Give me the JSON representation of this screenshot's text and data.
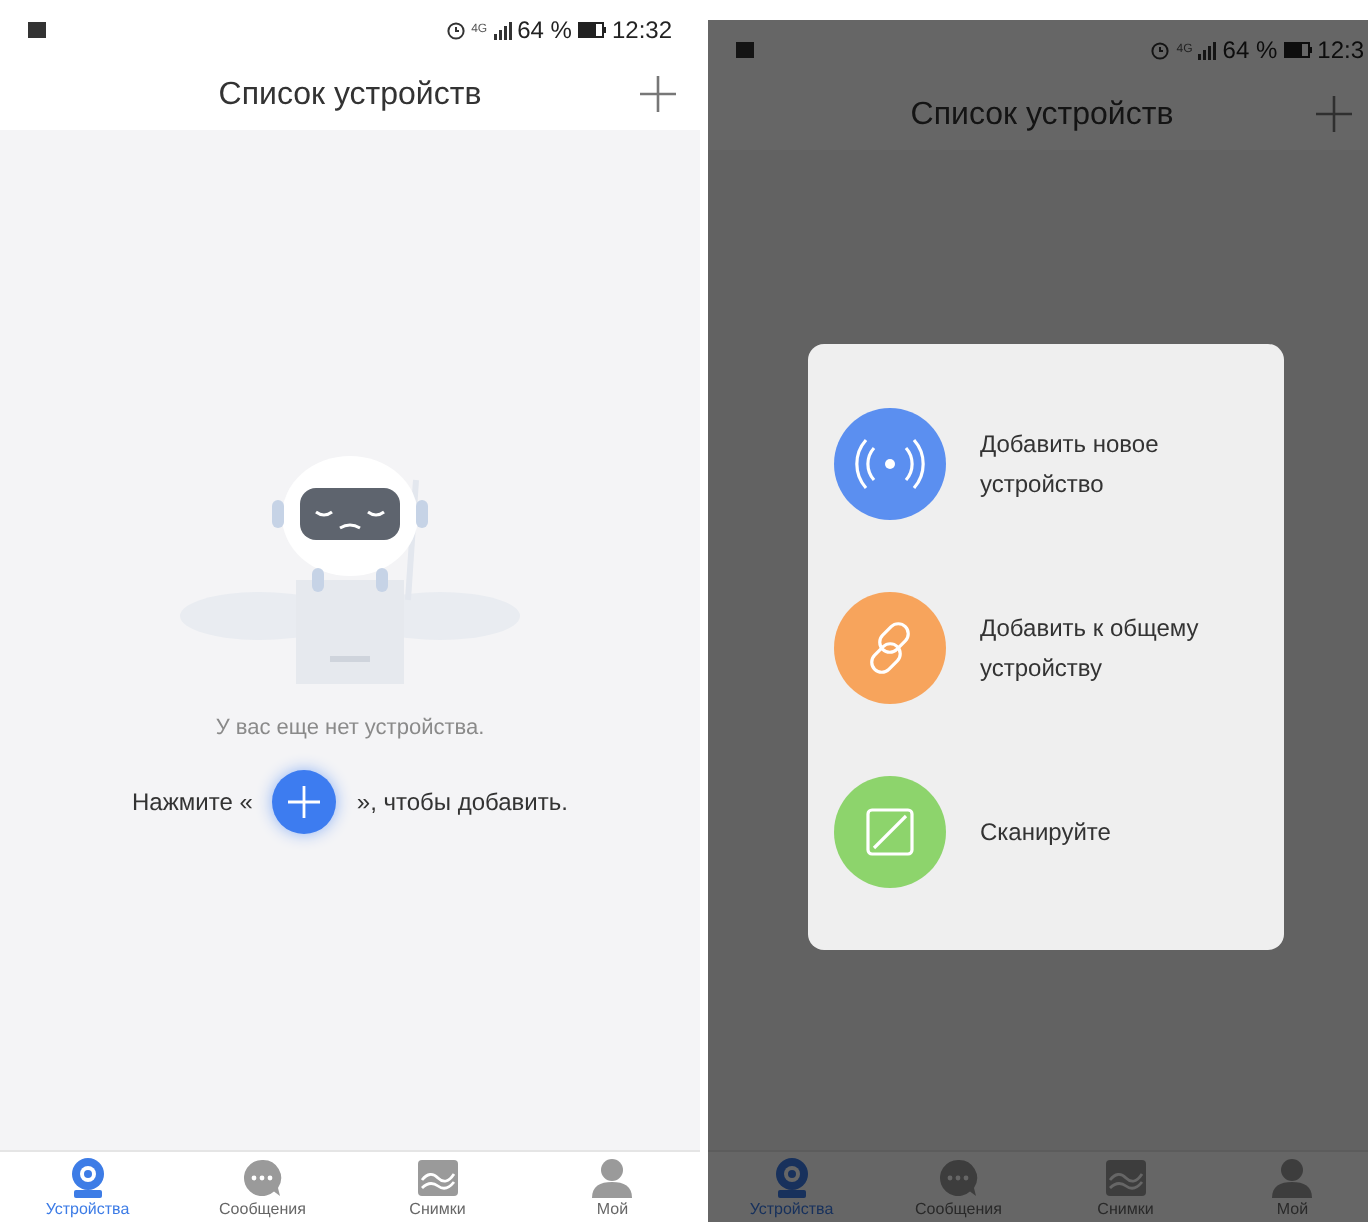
{
  "screens": [
    {
      "dimmed": false,
      "status_bar": {
        "network": "4G",
        "battery": "64 %",
        "time": "12:32"
      },
      "title": "Список устройств",
      "empty_state": {
        "message": "У вас еще нет устройства.",
        "hint_before": "Нажмите «",
        "hint_after": "», чтобы добавить."
      },
      "tabs": [
        {
          "label": "Устройства",
          "kind": "camera",
          "selected": true
        },
        {
          "label": "Сообщения",
          "kind": "chat",
          "selected": false
        },
        {
          "label": "Снимки",
          "kind": "picture",
          "selected": false
        },
        {
          "label": "Мой",
          "kind": "person",
          "selected": false
        }
      ]
    },
    {
      "dimmed": true,
      "status_bar": {
        "network": "4G",
        "battery": "64 %",
        "time": "12:3"
      },
      "title": "Список устройств",
      "tabs": [
        {
          "label": "Устройства",
          "kind": "camera",
          "selected": true
        },
        {
          "label": "Сообщения",
          "kind": "chat",
          "selected": false
        },
        {
          "label": "Снимки",
          "kind": "picture",
          "selected": false
        },
        {
          "label": "Мой",
          "kind": "person",
          "selected": false
        }
      ],
      "menu": {
        "items": [
          {
            "kind": "new",
            "label": "Добавить новое устройство"
          },
          {
            "kind": "shared",
            "label": "Добавить к общему устройству"
          },
          {
            "kind": "scan",
            "label": "Сканируйте"
          }
        ]
      }
    }
  ]
}
